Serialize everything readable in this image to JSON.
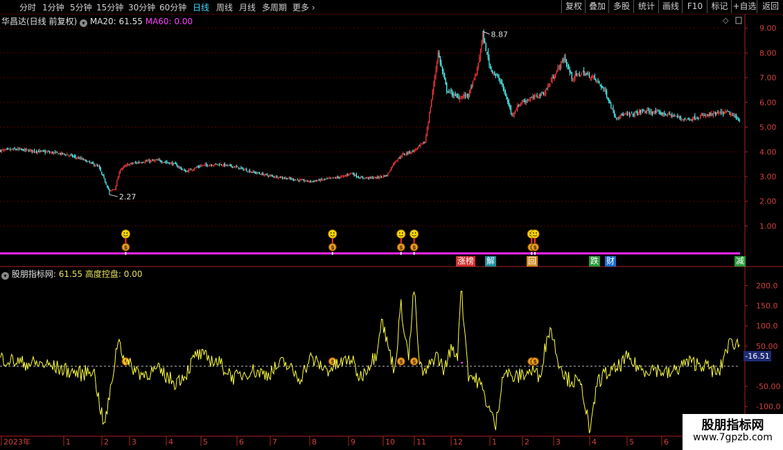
{
  "toolbar": {
    "items": [
      "分时",
      "1分钟",
      "5分钟",
      "15分钟",
      "30分钟",
      "60分钟",
      "日线",
      "周线",
      "月线",
      "多周期",
      "更多"
    ],
    "active": "日线",
    "right_buttons": [
      "复权",
      "叠加",
      "多股",
      "统计",
      "画线",
      "F10",
      "标记",
      "+自选",
      "返回"
    ]
  },
  "main": {
    "stock_label": "华昌达(日线 前复权)",
    "ma20_label": "MA20: 61.55",
    "ma60_label": "MA60: 0.00",
    "high_label": "8.87",
    "low_label": "2.27",
    "y_ticks": [
      "9.00",
      "8.00",
      "7.00",
      "6.00",
      "5.00",
      "4.00",
      "3.00",
      "2.00",
      "1.00"
    ]
  },
  "indicator": {
    "name": "股朋指标网",
    "value_label": ": 61.55",
    "extra_label": "高度控盘: 0.00",
    "current_value": "-16.51",
    "y_ticks": [
      "200.0",
      "150.0",
      "100.0",
      "50.00",
      "-50.00",
      "-100.0"
    ]
  },
  "event_tags": [
    {
      "label": "涨榜",
      "color": "#d43030"
    },
    {
      "label": "解",
      "color": "#1a8fa0"
    },
    {
      "label": "回",
      "color": "#d08a20"
    },
    {
      "label": "跌",
      "color": "#2a9a3a"
    },
    {
      "label": "财",
      "color": "#1a6fd0"
    },
    {
      "label": "减",
      "color": "#2a9a3a"
    }
  ],
  "timeline": {
    "labels": [
      "2023年",
      "1",
      "2",
      "3",
      "4",
      "5",
      "6",
      "7",
      "8",
      "9",
      "10",
      "11",
      "12",
      "1",
      "2",
      "3",
      "4",
      "5",
      "6"
    ]
  },
  "watermark": {
    "title": "股朋指标网",
    "url": "www.7gpzb.com"
  },
  "colors": {
    "up": "#ff3c3c",
    "down": "#54ffff",
    "indicator_line": "#ffff40",
    "divider": "#ff28ff",
    "axis": "#b02020"
  },
  "chart_data": {
    "type": "candlestick",
    "price_range": [
      0.2,
      9.3
    ],
    "price_high": 8.87,
    "price_low": 2.27,
    "indicator_range": [
      -170,
      230
    ],
    "close_anchors": [
      [
        0,
        4.05
      ],
      [
        15,
        4.1
      ],
      [
        40,
        4.0
      ],
      [
        60,
        3.9
      ],
      [
        75,
        3.7
      ],
      [
        90,
        3.4
      ],
      [
        100,
        2.4
      ],
      [
        105,
        2.5
      ],
      [
        110,
        3.3
      ],
      [
        118,
        3.5
      ],
      [
        130,
        3.6
      ],
      [
        145,
        3.65
      ],
      [
        160,
        3.5
      ],
      [
        170,
        3.2
      ],
      [
        185,
        3.45
      ],
      [
        200,
        3.5
      ],
      [
        215,
        3.4
      ],
      [
        230,
        3.2
      ],
      [
        245,
        3.05
      ],
      [
        260,
        2.95
      ],
      [
        275,
        2.85
      ],
      [
        285,
        2.8
      ],
      [
        300,
        2.9
      ],
      [
        315,
        3.0
      ],
      [
        322,
        3.15
      ],
      [
        330,
        2.95
      ],
      [
        345,
        2.95
      ],
      [
        355,
        3.05
      ],
      [
        362,
        3.6
      ],
      [
        370,
        3.9
      ],
      [
        380,
        4.05
      ],
      [
        390,
        4.4
      ],
      [
        395,
        5.8
      ],
      [
        402,
        8.0
      ],
      [
        410,
        6.5
      ],
      [
        420,
        6.2
      ],
      [
        430,
        6.3
      ],
      [
        438,
        7.3
      ],
      [
        443,
        8.7
      ],
      [
        450,
        7.4
      ],
      [
        460,
        6.8
      ],
      [
        470,
        5.5
      ],
      [
        478,
        6.0
      ],
      [
        490,
        6.2
      ],
      [
        500,
        6.4
      ],
      [
        510,
        7.2
      ],
      [
        518,
        7.8
      ],
      [
        525,
        7.0
      ],
      [
        535,
        7.2
      ],
      [
        545,
        7.0
      ],
      [
        555,
        6.5
      ],
      [
        565,
        5.4
      ],
      [
        572,
        5.5
      ],
      [
        580,
        5.5
      ],
      [
        590,
        5.65
      ],
      [
        600,
        5.6
      ],
      [
        615,
        5.5
      ],
      [
        630,
        5.3
      ],
      [
        645,
        5.45
      ],
      [
        660,
        5.55
      ],
      [
        668,
        5.6
      ],
      [
        675,
        5.4
      ],
      [
        679,
        5.3
      ]
    ],
    "indicator_anchors": [
      [
        0,
        20
      ],
      [
        20,
        8
      ],
      [
        40,
        5
      ],
      [
        60,
        -10
      ],
      [
        75,
        -20
      ],
      [
        85,
        -5
      ],
      [
        95,
        -150
      ],
      [
        100,
        -80
      ],
      [
        108,
        70
      ],
      [
        115,
        10
      ],
      [
        130,
        -20
      ],
      [
        145,
        -10
      ],
      [
        160,
        -40
      ],
      [
        170,
        -20
      ],
      [
        180,
        30
      ],
      [
        200,
        10
      ],
      [
        215,
        -30
      ],
      [
        230,
        -10
      ],
      [
        245,
        -20
      ],
      [
        260,
        10
      ],
      [
        275,
        -30
      ],
      [
        285,
        20
      ],
      [
        300,
        -10
      ],
      [
        315,
        10
      ],
      [
        322,
        20
      ],
      [
        330,
        -30
      ],
      [
        340,
        10
      ],
      [
        345,
        30
      ],
      [
        350,
        120
      ],
      [
        355,
        60
      ],
      [
        362,
        -10
      ],
      [
        368,
        150
      ],
      [
        375,
        20
      ],
      [
        380,
        195
      ],
      [
        385,
        0
      ],
      [
        390,
        -20
      ],
      [
        400,
        30
      ],
      [
        408,
        -10
      ],
      [
        413,
        40
      ],
      [
        420,
        30
      ],
      [
        423,
        200
      ],
      [
        430,
        -20
      ],
      [
        440,
        -40
      ],
      [
        447,
        -90
      ],
      [
        455,
        -150
      ],
      [
        462,
        -10
      ],
      [
        472,
        -30
      ],
      [
        480,
        -20
      ],
      [
        490,
        -10
      ],
      [
        495,
        -30
      ],
      [
        500,
        40
      ],
      [
        505,
        100
      ],
      [
        512,
        20
      ],
      [
        520,
        -30
      ],
      [
        530,
        -40
      ],
      [
        535,
        -60
      ],
      [
        542,
        -170
      ],
      [
        548,
        -40
      ],
      [
        555,
        -20
      ],
      [
        565,
        -10
      ],
      [
        575,
        20
      ],
      [
        590,
        -10
      ],
      [
        600,
        -5
      ],
      [
        615,
        -20
      ],
      [
        630,
        10
      ],
      [
        645,
        5
      ],
      [
        660,
        -20
      ],
      [
        667,
        45
      ],
      [
        672,
        60
      ],
      [
        679,
        55
      ]
    ],
    "signal_days": [
      115,
      305,
      368,
      380,
      488,
      491
    ],
    "high_day": 443,
    "low_day": 100,
    "n_days": 680
  }
}
